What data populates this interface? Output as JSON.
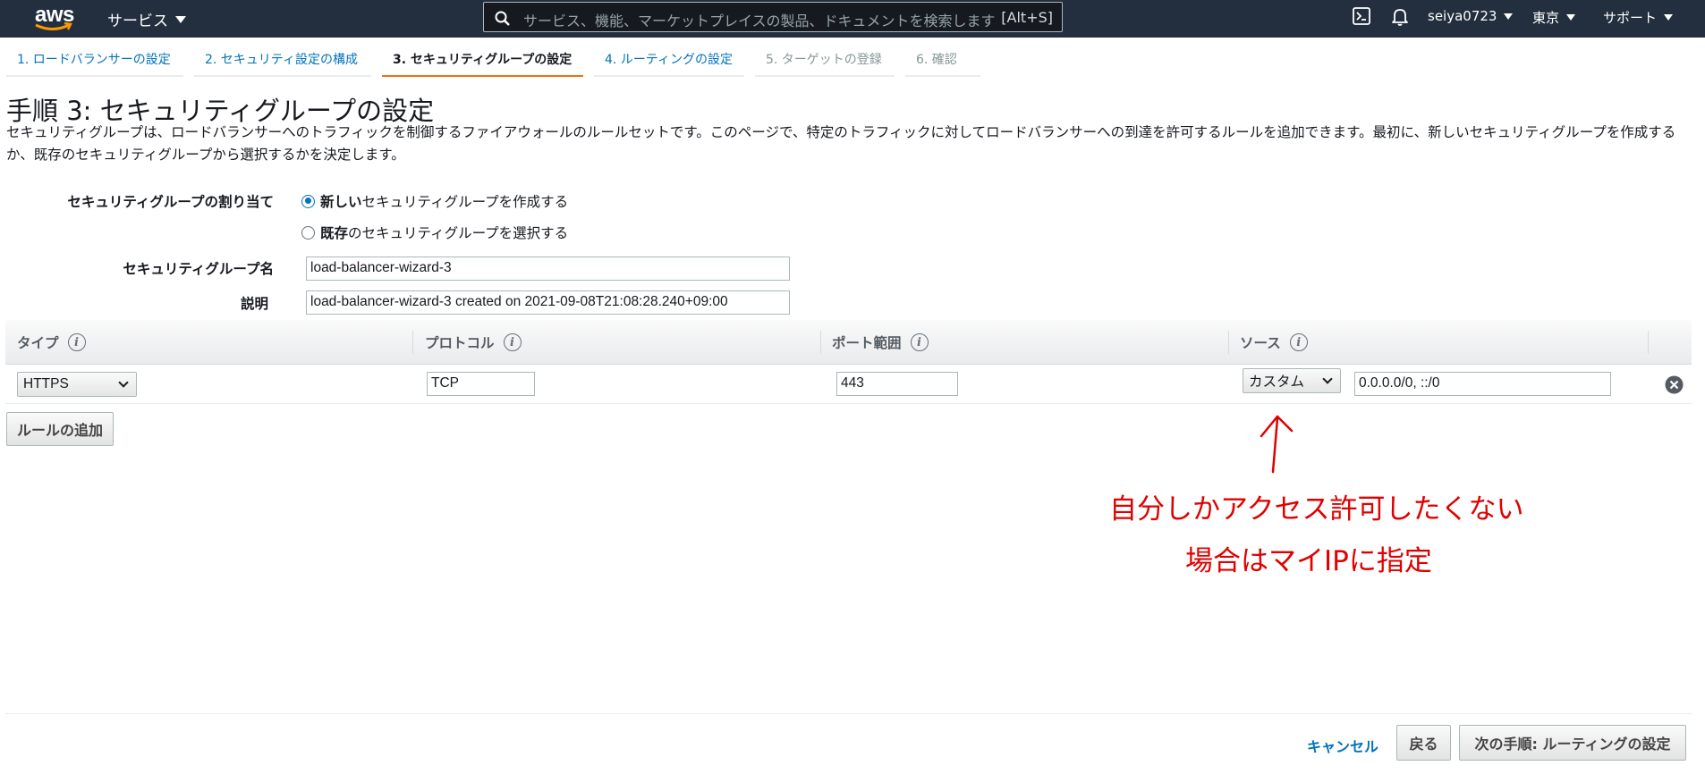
{
  "topnav": {
    "logo_text": "aws",
    "services_label": "サービス",
    "search_placeholder": "サービス、機能、マーケットプレイスの製品、ドキュメントを検索します",
    "search_shortcut": "[Alt+S]",
    "user": "seiya0723",
    "region": "東京",
    "support": "サポート"
  },
  "steps": [
    {
      "label": "1. ロードバランサーの設定",
      "state": "link"
    },
    {
      "label": "2. セキュリティ設定の構成",
      "state": "link"
    },
    {
      "label": "3. セキュリティグループの設定",
      "state": "active"
    },
    {
      "label": "4. ルーティングの設定",
      "state": "link"
    },
    {
      "label": "5. ターゲットの登録",
      "state": "disabled"
    },
    {
      "label": "6. 確認",
      "state": "disabled"
    }
  ],
  "page": {
    "title": "手順 3: セキュリティグループの設定",
    "description": "セキュリティグループは、ロードバランサーへのトラフィックを制御するファイアウォールのルールセットです。このページで、特定のトラフィックに対してロードバランサーへの到達を許可するルールを追加できます。最初に、新しいセキュリティグループを作成するか、既存のセキュリティグループから選択するかを決定します。"
  },
  "form": {
    "assign_label": "セキュリティグループの割り当て",
    "option_new_bold": "新しい",
    "option_new_rest": "セキュリティグループを作成する",
    "option_existing_bold": "既存",
    "option_existing_rest": "のセキュリティグループを選択する",
    "selected_option": "new",
    "name_label": "セキュリティグループ名",
    "name_value": "load-balancer-wizard-3",
    "desc_label": "説明",
    "desc_value": "load-balancer-wizard-3 created on 2021-09-08T21:08:28.240+09:00"
  },
  "rules": {
    "headers": {
      "type": "タイプ",
      "protocol": "プロトコル",
      "port": "ポート範囲",
      "source": "ソース"
    },
    "info_glyph": "i",
    "row": {
      "type": "HTTPS",
      "protocol": "TCP",
      "port": "443",
      "source_type": "カスタム",
      "source_value": "0.0.0.0/0, ::/0"
    },
    "add_rule_label": "ルールの追加"
  },
  "footer": {
    "cancel_label": "キャンセル",
    "back_label": "戻る",
    "next_label": "次の手順: ルーティングの設定"
  },
  "annotation": {
    "line1": "自分しかアクセス許可したくない",
    "line2": "場合はマイIPに指定",
    "color": "#e00000"
  },
  "colors": {
    "nav_bg": "#232f3e",
    "link": "#0073bb",
    "active_step": "#ec7211"
  }
}
